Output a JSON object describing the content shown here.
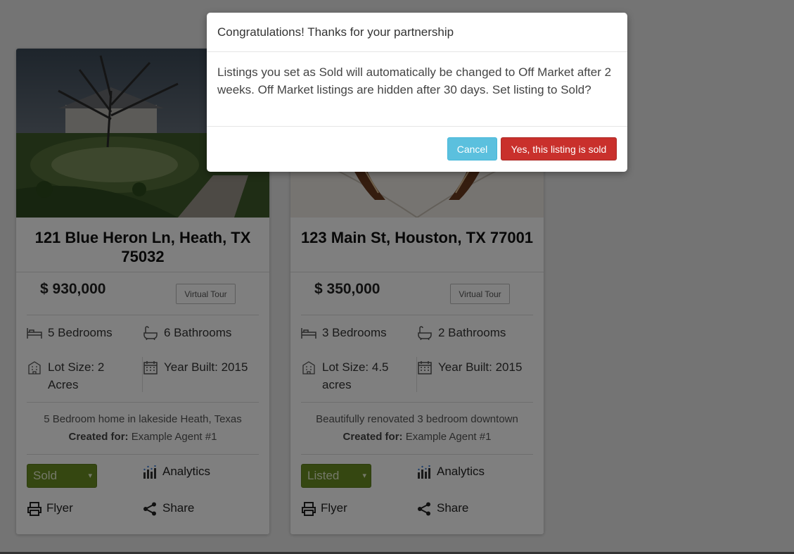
{
  "modal": {
    "title": "Congratulations! Thanks for your partnership",
    "body": "Listings you set as Sold will automatically be changed to Off Market after 2 weeks. Off Market listings are hidden after 30 days. Set listing to Sold?",
    "cancel_label": "Cancel",
    "confirm_label": "Yes, this listing is sold"
  },
  "listings": [
    {
      "address": "121 Blue Heron Ln, Heath, TX 75032",
      "price": "$ 930,000",
      "virtual_tour": "Virtual Tour",
      "bedrooms": "5 Bedrooms",
      "bathrooms": "6 Bathrooms",
      "lot_size": "Lot Size: 2 Acres",
      "year_built": "Year Built: 2015",
      "description": "5 Bedroom home in lakeside Heath, Texas",
      "created_for_label": "Created for:",
      "created_for": "Example Agent #1",
      "status": "Sold",
      "analytics": "Analytics",
      "flyer": "Flyer",
      "share": "Share"
    },
    {
      "address": "123 Main St, Houston, TX 77001",
      "price": "$ 350,000",
      "virtual_tour": "Virtual Tour",
      "bedrooms": "3 Bedrooms",
      "bathrooms": "2 Bathrooms",
      "lot_size": "Lot Size: 4.5 acres",
      "year_built": "Year Built: 2015",
      "description": "Beautifully renovated 3 bedroom downtown",
      "created_for_label": "Created for:",
      "created_for": "Example Agent #1",
      "status": "Listed",
      "analytics": "Analytics",
      "flyer": "Flyer",
      "share": "Share"
    }
  ],
  "colors": {
    "status_bg": "#6b8e23",
    "cancel_btn": "#5bc0de",
    "confirm_btn": "#c9302c",
    "overlay": "rgba(0,0,0,0.5)"
  },
  "icons": [
    "bed-icon",
    "bathtub-icon",
    "building-icon",
    "calendar-icon",
    "analytics-icon",
    "print-icon",
    "share-icon",
    "chevron-down-icon"
  ]
}
